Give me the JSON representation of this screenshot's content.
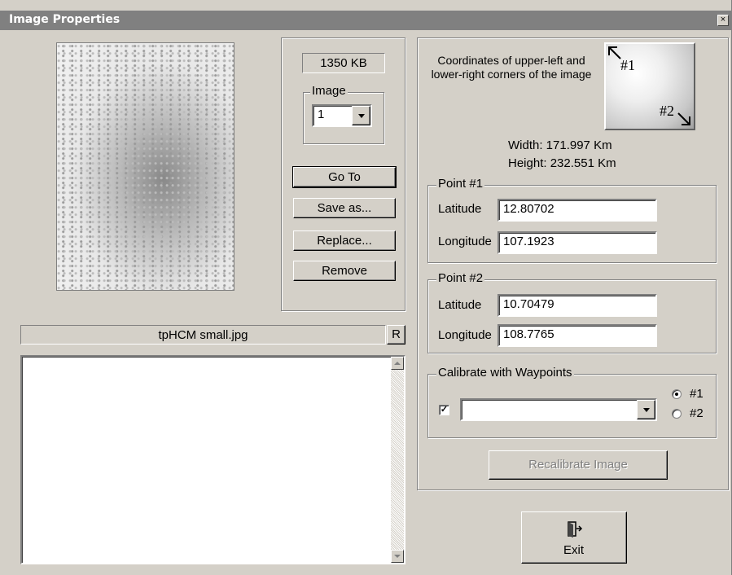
{
  "window": {
    "title": "Image Properties",
    "close_glyph": "×"
  },
  "image_panel": {
    "size_display": "1350 KB",
    "image_group_label": "Image",
    "image_selected": "1",
    "buttons": {
      "go_to": "Go To",
      "save_as": "Save as...",
      "replace": "Replace...",
      "remove": "Remove"
    },
    "filename": "tpHCM small.jpg",
    "r_button": "R"
  },
  "coordinates": {
    "description": "Coordinates of upper-left and lower-right corners of the image",
    "corner_labels": {
      "p1": "#1",
      "p2": "#2"
    },
    "width": "Width: 171.997 Km",
    "height": "Height: 232.551 Km",
    "point1": {
      "label": "Point #1",
      "lat_label": "Latitude",
      "lat": "12.80702",
      "lon_label": "Longitude",
      "lon": "107.1923"
    },
    "point2": {
      "label": "Point #2",
      "lat_label": "Latitude",
      "lat": "10.70479",
      "lon_label": "Longitude",
      "lon": "108.7765"
    }
  },
  "calibrate": {
    "group_label": "Calibrate with Waypoints",
    "checked": true,
    "waypoint_selected": "",
    "radio1": "#1",
    "radio2": "#2",
    "recalibrate_button": "Recalibrate Image"
  },
  "exit": {
    "label": "Exit",
    "icon": "exit-door-icon"
  }
}
